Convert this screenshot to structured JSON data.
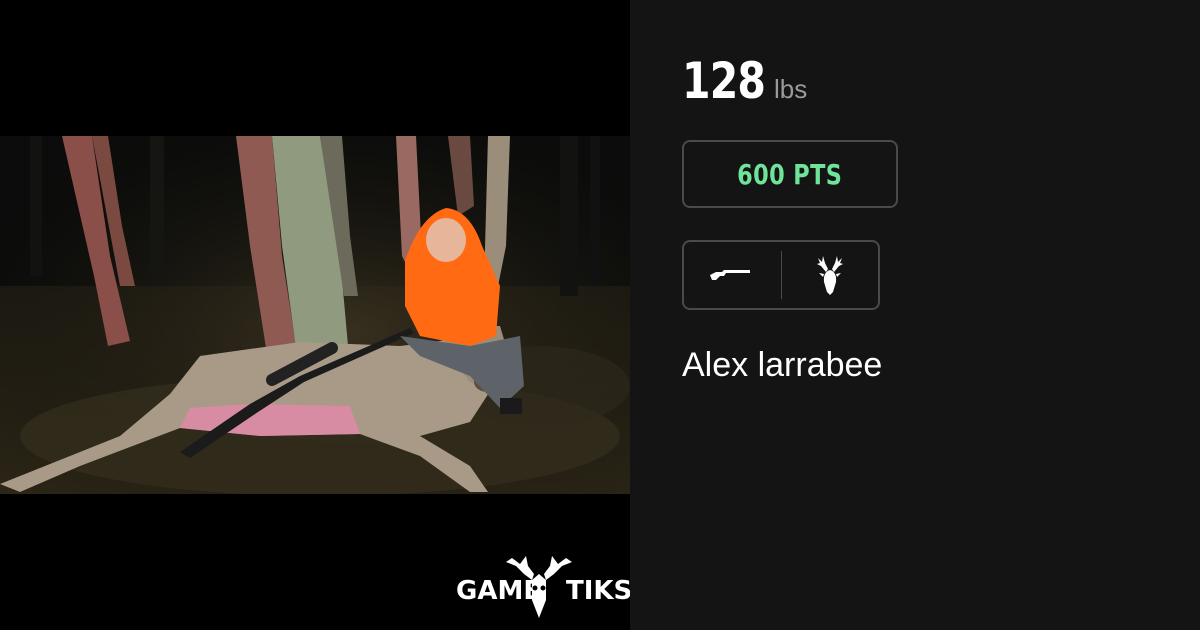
{
  "harvest": {
    "weight_value": "128",
    "weight_unit": "lbs",
    "points_label": "600 PTS",
    "weapon_icon": "rifle-icon",
    "species_icon": "deer-head-icon",
    "hunter_name": "Alex larrabee"
  },
  "photo": {
    "description_icon": "harvest-photo"
  },
  "brand": {
    "word_left": "GAME",
    "word_right": "TIKS",
    "logo_icon": "deer-skull-icon"
  },
  "colors": {
    "background": "#141414",
    "photo_background": "#000000",
    "points_green": "#6fe39a",
    "border": "#4a4a4a",
    "unit_gray": "#9a9a9a",
    "hunter_orange": "#ff6a13"
  }
}
